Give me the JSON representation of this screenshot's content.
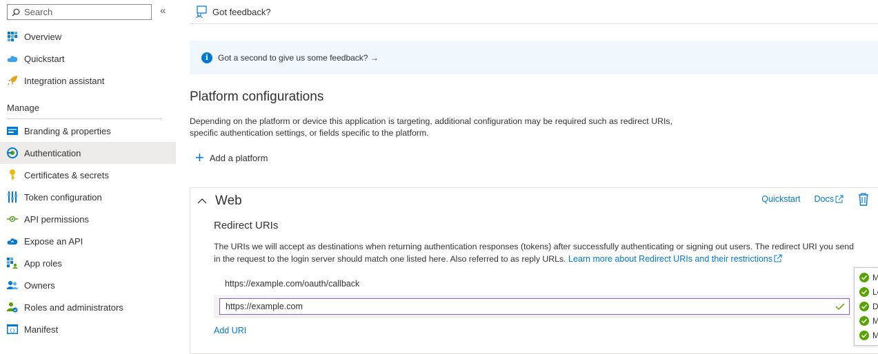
{
  "search": {
    "placeholder": "Search"
  },
  "sidebar": {
    "items_top": [
      {
        "label": "Overview"
      },
      {
        "label": "Quickstart"
      },
      {
        "label": "Integration assistant"
      }
    ],
    "section": "Manage",
    "items_manage": [
      {
        "label": "Branding & properties"
      },
      {
        "label": "Authentication",
        "active": true
      },
      {
        "label": "Certificates & secrets"
      },
      {
        "label": "Token configuration"
      },
      {
        "label": "API permissions"
      },
      {
        "label": "Expose an API"
      },
      {
        "label": "App roles"
      },
      {
        "label": "Owners"
      },
      {
        "label": "Roles and administrators"
      },
      {
        "label": "Manifest"
      }
    ]
  },
  "topbar": {
    "feedback_label": "Got feedback?"
  },
  "banner": {
    "text": "Got a second to give us some feedback? →"
  },
  "main": {
    "title": "Platform configurations",
    "description": "Depending on the platform or device this application is targeting, additional configuration may be required such as redirect URIs, specific authentication settings, or fields specific to the platform.",
    "add_platform_label": "Add a platform"
  },
  "card": {
    "title": "Web",
    "quickstart_label": "Quickstart",
    "docs_label": "Docs",
    "redirect_title": "Redirect URIs",
    "redirect_desc": "The URIs we will accept as destinations when returning authentication responses (tokens) after successfully authenticating or signing out users. The redirect URI you send in the request to the login server should match one listed here. Also referred to as reply URLs. ",
    "learn_more_label": "Learn more about Redirect URIs and their restrictions",
    "uris": [
      "https://example.com/oauth/callback"
    ],
    "uri_input_value": "https://example.com",
    "add_uri_label": "Add URI"
  },
  "popup": {
    "items": [
      "M",
      "Le",
      "D",
      "M",
      "M"
    ]
  },
  "colors": {
    "accent": "#0078d4",
    "active_bg": "#edebe9",
    "banner_bg": "#eff6fc",
    "success": "#57a300",
    "focus_border": "#8764b8"
  }
}
